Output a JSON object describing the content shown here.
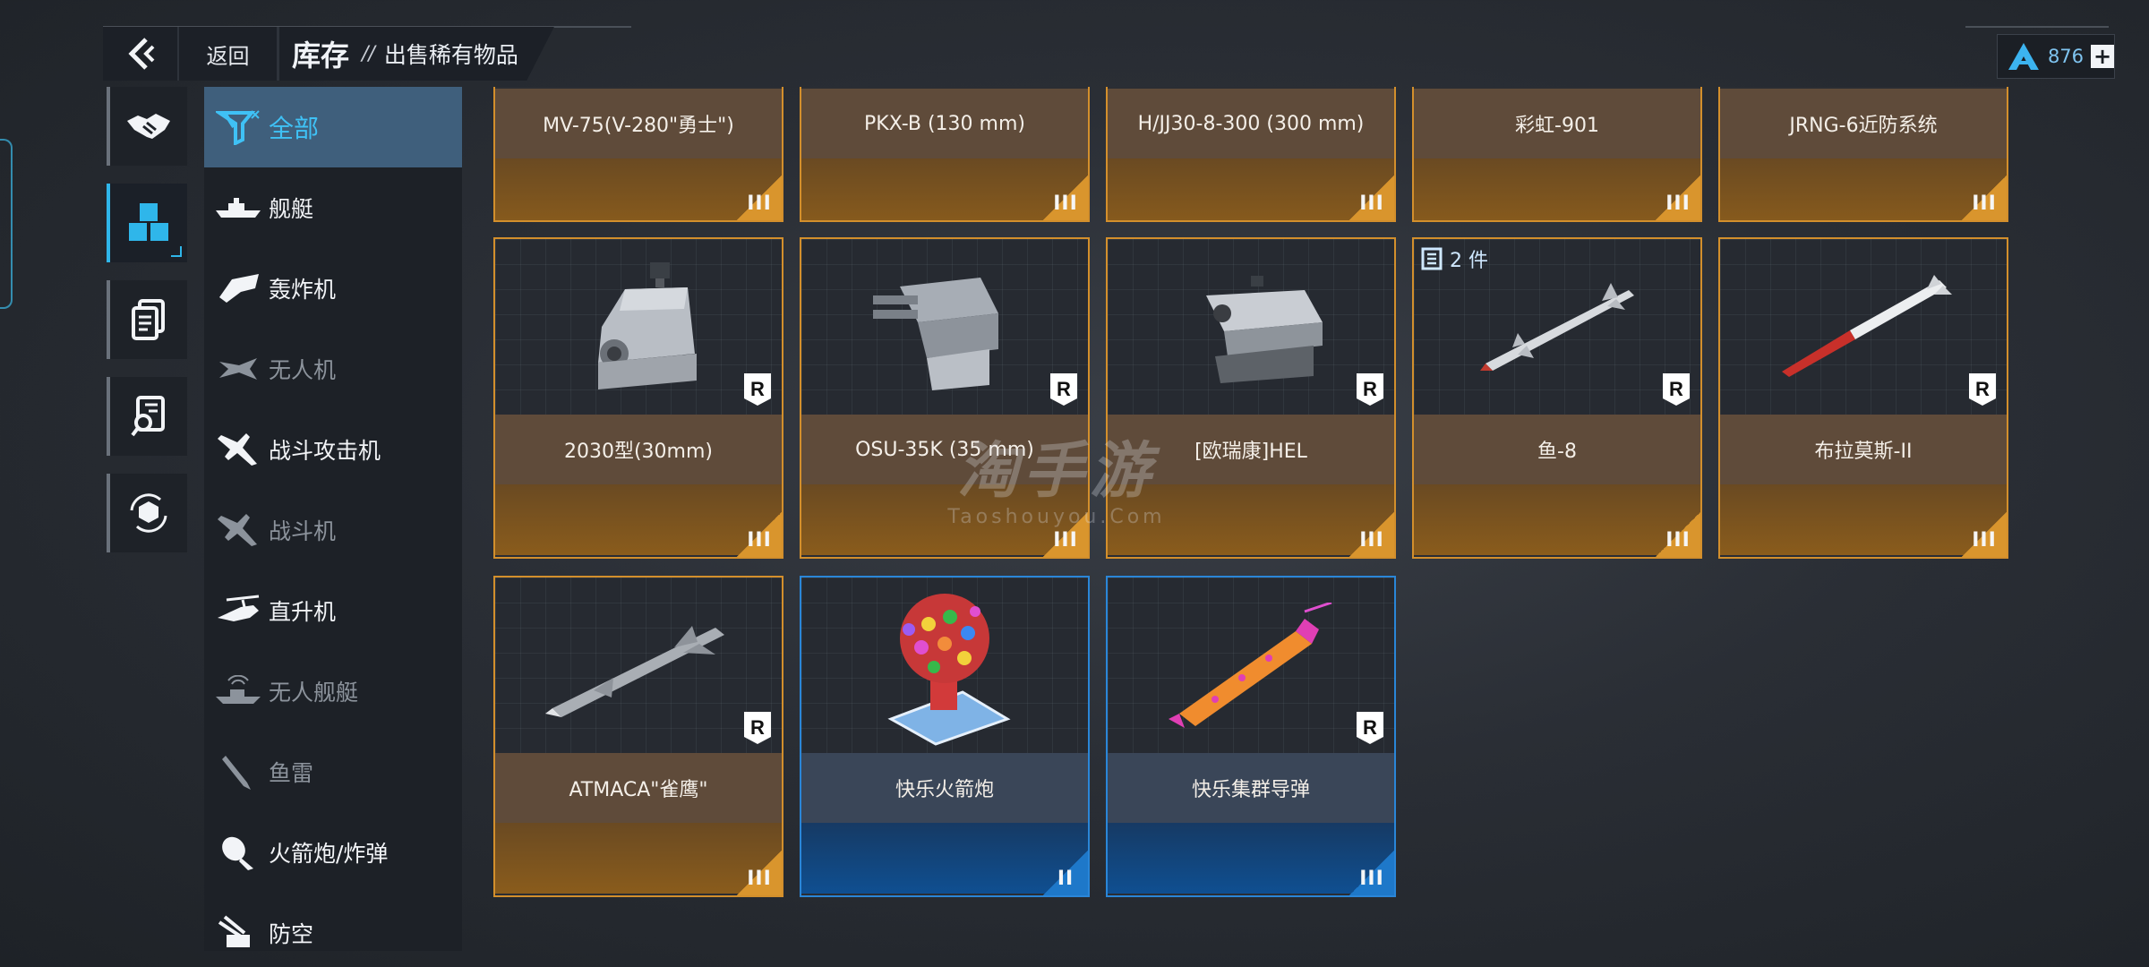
{
  "topbar": {
    "back_label": "返回",
    "title": "库存",
    "separator": "//",
    "subtitle": "出售稀有物品"
  },
  "currency": {
    "amount": "876"
  },
  "side_icons": [
    "handshake-icon",
    "cubes-icon",
    "document-list-icon",
    "document-search-icon",
    "cube-refresh-icon"
  ],
  "categories": [
    {
      "label": "全部",
      "icon": "all-items-icon",
      "state": "active"
    },
    {
      "label": "舰艇",
      "icon": "ship-icon",
      "state": "normal"
    },
    {
      "label": "轰炸机",
      "icon": "bomber-icon",
      "state": "normal"
    },
    {
      "label": "无人机",
      "icon": "drone-icon",
      "state": "dim"
    },
    {
      "label": "战斗攻击机",
      "icon": "fighter-attack-icon",
      "state": "normal"
    },
    {
      "label": "战斗机",
      "icon": "fighter-icon",
      "state": "dim"
    },
    {
      "label": "直升机",
      "icon": "helicopter-icon",
      "state": "normal"
    },
    {
      "label": "无人舰艇",
      "icon": "unmanned-boat-icon",
      "state": "dim"
    },
    {
      "label": "鱼雷",
      "icon": "torpedo-icon",
      "state": "dim"
    },
    {
      "label": "火箭炮/炸弹",
      "icon": "rocket-bomb-icon",
      "state": "normal"
    },
    {
      "label": "防空",
      "icon": "anti-air-icon",
      "state": "normal"
    }
  ],
  "items": [
    {
      "name": "MV-75(V-280\"勇士\")",
      "tier": "III",
      "rarity": "orange",
      "image": "none",
      "partial": true
    },
    {
      "name": "PKX-B (130 mm)",
      "tier": "III",
      "rarity": "orange",
      "image": "none",
      "partial": true
    },
    {
      "name": "H/JJ30-8-300 (300 mm)",
      "tier": "III",
      "rarity": "orange",
      "image": "none",
      "partial": true
    },
    {
      "name": "彩虹-901",
      "tier": "III",
      "rarity": "orange",
      "image": "none",
      "partial": true
    },
    {
      "name": "JRNG-6近防系统",
      "tier": "III",
      "rarity": "orange",
      "image": "none",
      "partial": true
    },
    {
      "name": "2030型(30mm)",
      "tier": "III",
      "rarity": "orange",
      "image": "turret-gun-icon",
      "badge": "R"
    },
    {
      "name": "OSU-35K (35 mm)",
      "tier": "III",
      "rarity": "orange",
      "image": "turret-twin-icon",
      "badge": "R"
    },
    {
      "name": "[欧瑞康]HEL",
      "tier": "III",
      "rarity": "orange",
      "image": "laser-turret-icon",
      "badge": "R"
    },
    {
      "name": "鱼-8",
      "tier": "III",
      "rarity": "orange",
      "image": "missile-icon",
      "badge": "R",
      "quantity": "2 件"
    },
    {
      "name": "布拉莫斯-II",
      "tier": "III",
      "rarity": "orange",
      "image": "red-missile-icon",
      "badge": "R"
    },
    {
      "name": "ATMACA\"雀鹰\"",
      "tier": "III",
      "rarity": "orange",
      "image": "cruise-missile-icon",
      "badge": "R"
    },
    {
      "name": "快乐火箭炮",
      "tier": "II",
      "rarity": "blue",
      "image": "party-rocket-launcher-icon"
    },
    {
      "name": "快乐集群导弹",
      "tier": "III",
      "rarity": "blue",
      "image": "party-missile-icon",
      "badge": "R"
    }
  ],
  "watermark": {
    "main": "淘手游",
    "url": "Taoshouyou.Com"
  }
}
